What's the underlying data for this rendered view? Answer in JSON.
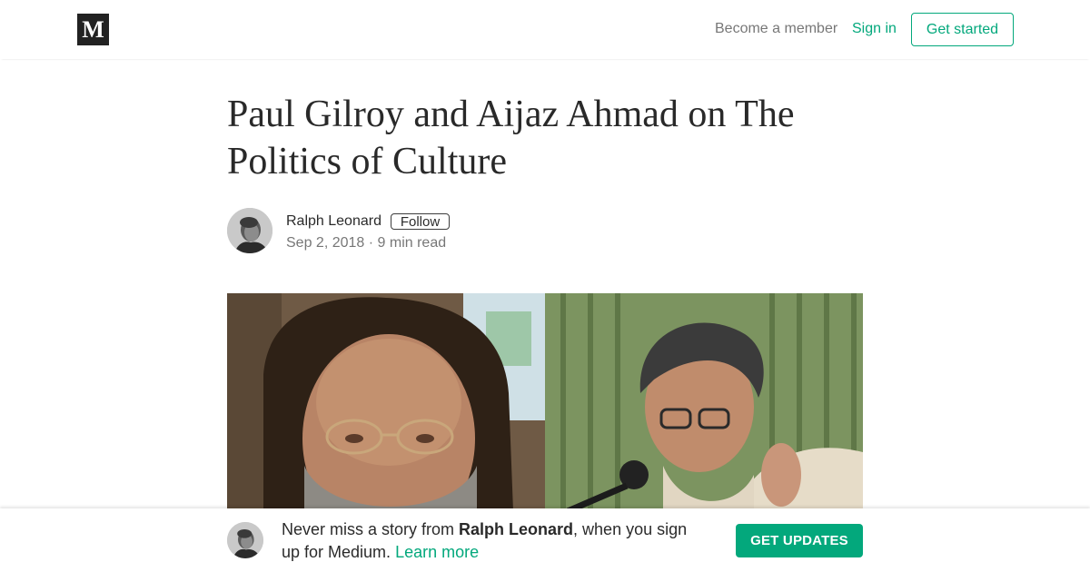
{
  "header": {
    "logo_text": "M",
    "become_member": "Become a member",
    "sign_in": "Sign in",
    "get_started": "Get started"
  },
  "article": {
    "title": "Paul Gilroy and Aijaz Ahmad on The Politics of Culture",
    "author": "Ralph Leonard",
    "follow_label": "Follow",
    "date": "Sep 2, 2018",
    "separator": " · ",
    "read_time": "9 min read"
  },
  "footer": {
    "promo_prefix": "Never miss a story from ",
    "promo_author": "Ralph Leonard",
    "promo_suffix": ", when you sign up for Medium. ",
    "learn_more": "Learn more",
    "get_updates": "GET UPDATES"
  },
  "colors": {
    "accent": "#03a87c",
    "logo_bg": "#222222"
  }
}
